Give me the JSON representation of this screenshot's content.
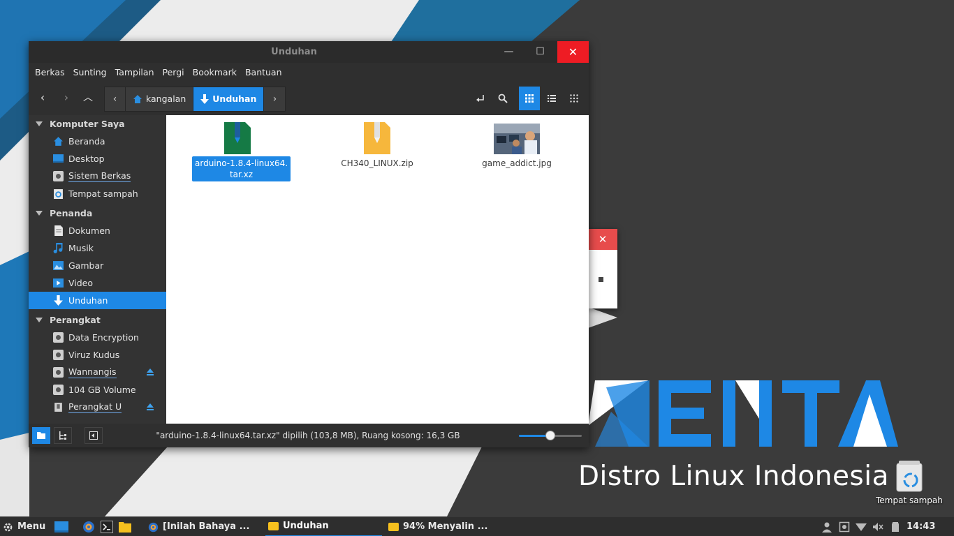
{
  "window": {
    "title": "Unduhan",
    "minimize_glyph": "—",
    "maximize_glyph": "☐",
    "close_glyph": "✕"
  },
  "menubar": [
    "Berkas",
    "Sunting",
    "Tampilan",
    "Pergi",
    "Bookmark",
    "Bantuan"
  ],
  "toolbar": {
    "back_glyph": "‹",
    "forward_glyph": "›",
    "up_glyph": "︿",
    "crumb_left_glyph": "‹",
    "crumb_right_glyph": "›",
    "breadcrumbs": [
      {
        "label": "kangalan",
        "icon": "home-icon"
      },
      {
        "label": "Unduhan",
        "icon": "download-icon",
        "active": true
      }
    ]
  },
  "sidebar": {
    "sections": [
      {
        "title": "Komputer Saya",
        "items": [
          {
            "label": "Beranda",
            "icon": "home-icon"
          },
          {
            "label": "Desktop",
            "icon": "desktop-icon"
          },
          {
            "label": "Sistem Berkas",
            "icon": "drive-icon",
            "underline": true
          },
          {
            "label": "Tempat sampah",
            "icon": "trash-icon"
          }
        ]
      },
      {
        "title": "Penanda",
        "items": [
          {
            "label": "Dokumen",
            "icon": "document-icon"
          },
          {
            "label": "Musik",
            "icon": "music-icon"
          },
          {
            "label": "Gambar",
            "icon": "picture-icon"
          },
          {
            "label": "Video",
            "icon": "video-icon"
          },
          {
            "label": "Unduhan",
            "icon": "download-icon",
            "active": true
          }
        ]
      },
      {
        "title": "Perangkat",
        "items": [
          {
            "label": "Data Encryption",
            "icon": "drive-icon"
          },
          {
            "label": "Viruz Kudus",
            "icon": "drive-icon"
          },
          {
            "label": "Wannangis",
            "icon": "drive-icon",
            "eject": true,
            "underline": true
          },
          {
            "label": "104 GB Volume",
            "icon": "drive-icon"
          },
          {
            "label": "Perangkat U",
            "icon": "usb-icon",
            "eject": true,
            "underline": true
          }
        ]
      }
    ]
  },
  "files": [
    {
      "name": "arduino-1.8.4-linux64.\ntar.xz",
      "type": "archive-xz",
      "selected": true
    },
    {
      "name": "CH340_LINUX.zip",
      "type": "archive-zip"
    },
    {
      "name": "game_addict.jpg",
      "type": "image-jpg"
    }
  ],
  "status": {
    "text": "\"arduino-1.8.4-linux64.tar.xz\" dipilih (103,8 MB), Ruang kosong: 16,3 GB",
    "zoom_level": 0.5
  },
  "desktop": {
    "brand_text": "Distro Linux Indonesia",
    "trash_label": "Tempat sampah",
    "bg_window_close_glyph": "✕"
  },
  "taskbar": {
    "menu_label": "Menu",
    "tasks": [
      {
        "label": "[Inilah Bahaya ...",
        "icon": "browser-icon"
      },
      {
        "label": "Unduhan",
        "icon": "folder-icon",
        "active": true
      },
      {
        "label": "94% Menyalin ...",
        "icon": "folder-icon"
      }
    ],
    "clock": "14:43"
  },
  "colors": {
    "accent": "#1e88e5",
    "close_red": "#ee1c24",
    "folder_yellow": "#f6c01e"
  }
}
